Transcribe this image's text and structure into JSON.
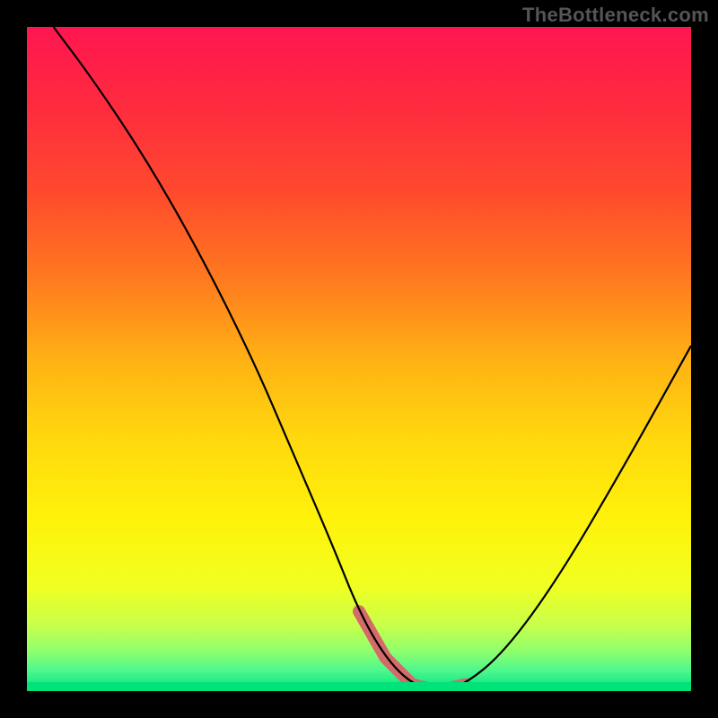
{
  "watermark": "TheBottleneck.com",
  "colors": {
    "background": "#000000",
    "gradient_stops": [
      {
        "offset": 0.0,
        "color": "#ff1650"
      },
      {
        "offset": 0.12,
        "color": "#ff2b3f"
      },
      {
        "offset": 0.25,
        "color": "#ff4a2d"
      },
      {
        "offset": 0.38,
        "color": "#ff7a1f"
      },
      {
        "offset": 0.5,
        "color": "#ffb114"
      },
      {
        "offset": 0.62,
        "color": "#ffd80e"
      },
      {
        "offset": 0.74,
        "color": "#fff20a"
      },
      {
        "offset": 0.84,
        "color": "#f1ff20"
      },
      {
        "offset": 0.9,
        "color": "#c9ff4a"
      },
      {
        "offset": 0.94,
        "color": "#8fff6d"
      },
      {
        "offset": 0.97,
        "color": "#4bf78f"
      },
      {
        "offset": 1.0,
        "color": "#00e27a"
      }
    ],
    "curve": "#000000",
    "trough_marker": "#d46a6a",
    "bottom_strip": "#00e27a"
  },
  "chart_data": {
    "type": "line",
    "title": "",
    "xlabel": "",
    "ylabel": "",
    "xlim": [
      0,
      100
    ],
    "ylim": [
      0,
      100
    ],
    "series": [
      {
        "name": "bottleneck-curve",
        "x": [
          4,
          10,
          18,
          26,
          34,
          40,
          46,
          50,
          54,
          58,
          62,
          66,
          72,
          80,
          90,
          100
        ],
        "y": [
          100,
          92,
          80,
          66,
          50,
          36,
          22,
          12,
          5,
          1,
          0,
          1,
          6,
          17,
          34,
          52
        ]
      }
    ],
    "trough_range_x": [
      50,
      66
    ],
    "annotations": []
  }
}
